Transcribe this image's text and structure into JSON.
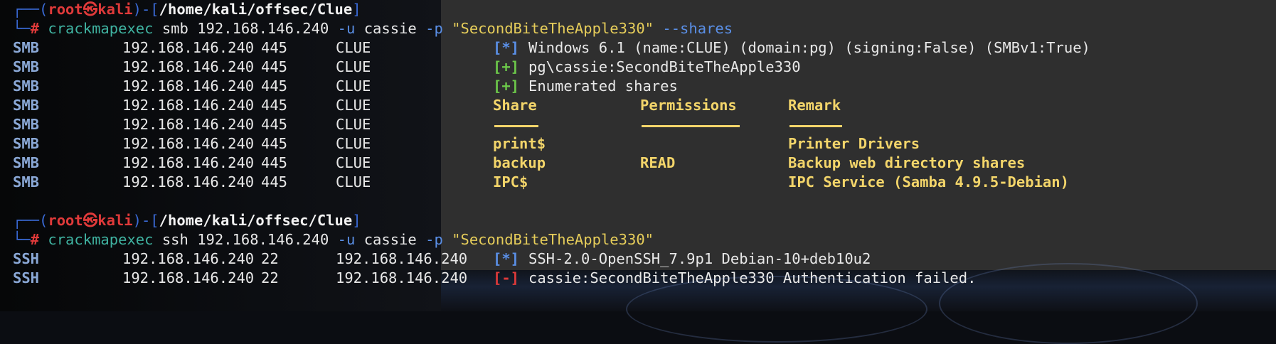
{
  "prompt1": {
    "user": "root",
    "host": "kali",
    "path": "/home/kali/offsec/Clue",
    "symbol": "㉿",
    "hash": "#"
  },
  "cmd1": {
    "binary": "crackmapexec",
    "args": "smb 192.168.146.240",
    "flag_u": "-u",
    "user": "cassie",
    "flag_p": "-p",
    "password": "\"SecondBiteTheApple330\"",
    "extra": "--shares"
  },
  "smb_rows": [
    {
      "proto": "SMB",
      "ip": "192.168.146.240",
      "port": "445",
      "name": "CLUE",
      "tag": "[*]",
      "tag_type": "info",
      "msg": "Windows 6.1 (name:CLUE) (domain:pg) (signing:False) (SMBv1:True)"
    },
    {
      "proto": "SMB",
      "ip": "192.168.146.240",
      "port": "445",
      "name": "CLUE",
      "tag": "[+]",
      "tag_type": "ok",
      "msg": "pg\\cassie:SecondBiteTheApple330"
    },
    {
      "proto": "SMB",
      "ip": "192.168.146.240",
      "port": "445",
      "name": "CLUE",
      "tag": "[+]",
      "tag_type": "ok",
      "msg": "Enumerated shares"
    },
    {
      "proto": "SMB",
      "ip": "192.168.146.240",
      "port": "445",
      "name": "CLUE"
    },
    {
      "proto": "SMB",
      "ip": "192.168.146.240",
      "port": "445",
      "name": "CLUE"
    },
    {
      "proto": "SMB",
      "ip": "192.168.146.240",
      "port": "445",
      "name": "CLUE"
    },
    {
      "proto": "SMB",
      "ip": "192.168.146.240",
      "port": "445",
      "name": "CLUE"
    },
    {
      "proto": "SMB",
      "ip": "192.168.146.240",
      "port": "445",
      "name": "CLUE"
    }
  ],
  "shares_table": {
    "headers": [
      "Share",
      "Permissions",
      "Remark"
    ],
    "rows": [
      {
        "share": "print$",
        "perm": "",
        "remark": "Printer Drivers"
      },
      {
        "share": "backup",
        "perm": "READ",
        "remark": "Backup web directory shares"
      },
      {
        "share": "IPC$",
        "perm": "",
        "remark": "IPC Service (Samba 4.9.5-Debian)"
      }
    ]
  },
  "prompt2": {
    "user": "root",
    "host": "kali",
    "path": "/home/kali/offsec/Clue",
    "symbol": "㉿",
    "hash": "#"
  },
  "cmd2": {
    "binary": "crackmapexec",
    "args": "ssh 192.168.146.240",
    "flag_u": "-u",
    "user": "cassie",
    "flag_p": "-p",
    "password": "\"SecondBiteTheApple330\""
  },
  "ssh_rows": [
    {
      "proto": "SSH",
      "ip": "192.168.146.240",
      "port": "22",
      "name": "192.168.146.240",
      "tag": "[*]",
      "tag_type": "info",
      "msg": "SSH-2.0-OpenSSH_7.9p1 Debian-10+deb10u2"
    },
    {
      "proto": "SSH",
      "ip": "192.168.146.240",
      "port": "22",
      "name": "192.168.146.240",
      "tag": "[-]",
      "tag_type": "err",
      "msg": "cassie:SecondBiteTheApple330 Authentication failed."
    }
  ],
  "colors": {
    "prompt_frame": "#3a6ad6",
    "prompt_user": "#e03a3a",
    "command": "#3fb2a0",
    "string": "#e6cd5a",
    "table_header": "#f3d56a"
  }
}
